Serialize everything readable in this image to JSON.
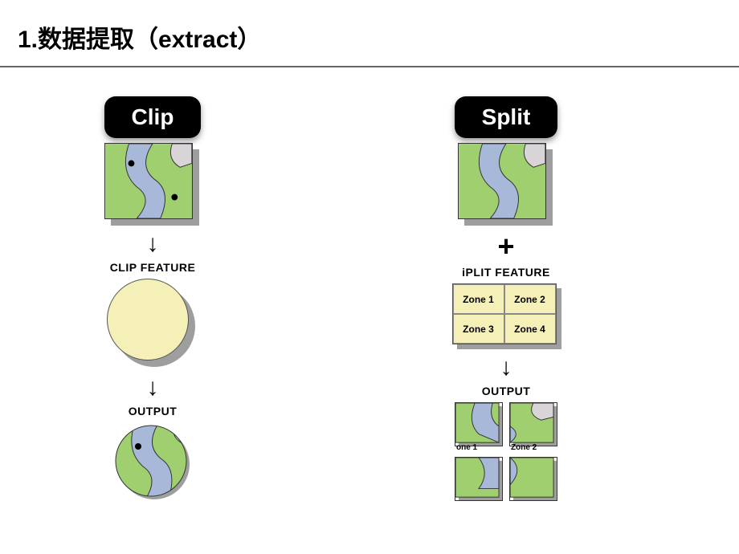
{
  "title": "1.数据提取（extract）",
  "clip": {
    "pill": "Clip",
    "feature_label": "CLIP FEATURE",
    "output_label": "OUTPUT"
  },
  "split": {
    "pill": "Split",
    "feature_label": "iPLIT FEATURE",
    "zones": [
      "Zone 1",
      "Zone 2",
      "Zone 3",
      "Zone 4"
    ],
    "output_label": "OUTPUT",
    "output_tiles": [
      "one 1",
      "Zone 2",
      "",
      ""
    ]
  },
  "colors": {
    "land": "#a0cf70",
    "water": "#a7b8d8",
    "sand": "#d8d4d8",
    "zone_fill": "#f5f0b8",
    "dot": "#000000"
  }
}
